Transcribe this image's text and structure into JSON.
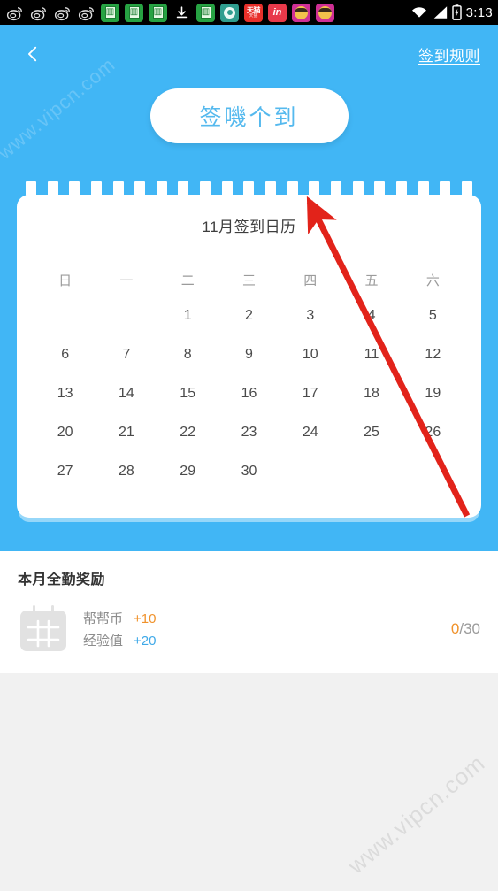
{
  "statusbar": {
    "time": "3:13",
    "left_icons": [
      {
        "name": "weibo-icon",
        "type": "weibo"
      },
      {
        "name": "weibo-icon",
        "type": "weibo"
      },
      {
        "name": "weibo-icon",
        "type": "weibo"
      },
      {
        "name": "weibo-icon",
        "type": "weibo"
      },
      {
        "name": "mahjong-app-icon",
        "type": "green",
        "glyph": "█"
      },
      {
        "name": "mahjong-app-icon",
        "type": "green",
        "glyph": "█"
      },
      {
        "name": "mahjong-app-icon",
        "type": "green",
        "glyph": "█"
      },
      {
        "name": "download-icon",
        "type": "download"
      },
      {
        "name": "mahjong-app-icon",
        "type": "green",
        "glyph": "█"
      },
      {
        "name": "sync-app-icon",
        "type": "teal"
      },
      {
        "name": "tmall-icon",
        "type": "tmall",
        "label": "天猫",
        "sub": "天猫"
      },
      {
        "name": "linkedin-icon",
        "type": "in",
        "label": "in"
      },
      {
        "name": "avatar-app-icon",
        "type": "face"
      },
      {
        "name": "avatar-app-icon",
        "type": "face"
      }
    ],
    "right_icons": [
      "wifi-icon",
      "signal-icon",
      "battery-charging-icon"
    ]
  },
  "header": {
    "back_label": "返回",
    "rules_label": "签到规则"
  },
  "hero": {
    "signin_button_label": "签嘰个到",
    "background_color": "#41b6f5"
  },
  "calendar": {
    "title": "11月签到日历",
    "weekdays": [
      "日",
      "一",
      "二",
      "三",
      "四",
      "五",
      "六"
    ],
    "tab_count": 21,
    "weeks": [
      [
        "",
        "",
        "1",
        "2",
        "3",
        "4",
        "5"
      ],
      [
        "6",
        "7",
        "8",
        "9",
        "10",
        "11",
        "12"
      ],
      [
        "13",
        "14",
        "15",
        "16",
        "17",
        "18",
        "19"
      ],
      [
        "20",
        "21",
        "22",
        "23",
        "24",
        "25",
        "26"
      ],
      [
        "27",
        "28",
        "29",
        "30",
        "",
        "",
        ""
      ]
    ]
  },
  "reward": {
    "title": "本月全勤奖励",
    "icon_name": "calendar-icon",
    "lines": [
      {
        "label": "帮帮币",
        "value": "+10",
        "color": "#f0922b"
      },
      {
        "label": "经验值",
        "value": "+20",
        "color": "#3fa9e8"
      }
    ],
    "progress_current": "0",
    "progress_total": "/30"
  },
  "annotations": {
    "arrow_color": "#e2231a",
    "watermark_top": "www.vipcn.com",
    "watermark_bottom": "www.vipcn.com"
  }
}
